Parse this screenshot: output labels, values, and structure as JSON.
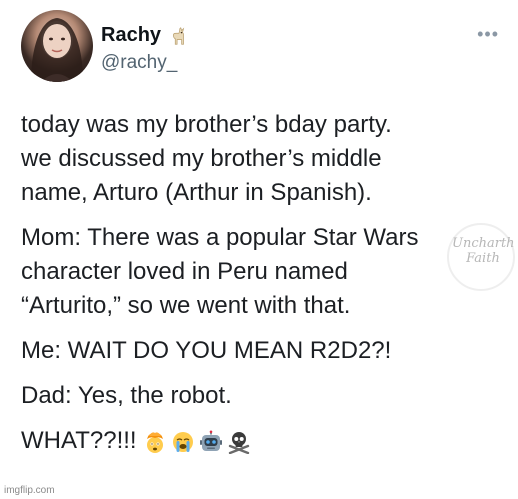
{
  "author": {
    "name": "Rachy",
    "handle": "@rachy_",
    "name_emoji_icon": "llama-icon"
  },
  "menu": {
    "more_label": "•••"
  },
  "tweet": {
    "paragraphs": [
      "today was my brother’s bday party.\nwe discussed my brother’s middle\nname, Arturo (Arthur in Spanish).",
      "Mom: There was a popular Star Wars\ncharacter loved in Peru named\n“Arturito,” so we went with that.",
      "Me: WAIT DO YOU MEAN R2D2?!",
      "Dad: Yes, the robot."
    ],
    "last_line_text": "WHAT??!!!",
    "last_line_emojis": [
      "exploding-head-icon",
      "crying-face-icon",
      "robot-icon",
      "skull-crossbones-icon"
    ]
  },
  "watermark": {
    "text": "Uncharth\nFaith"
  },
  "footer": {
    "credit": "imgflip.com"
  },
  "colors": {
    "text": "#1c1f23",
    "secondary": "#536471",
    "background": "#ffffff"
  }
}
